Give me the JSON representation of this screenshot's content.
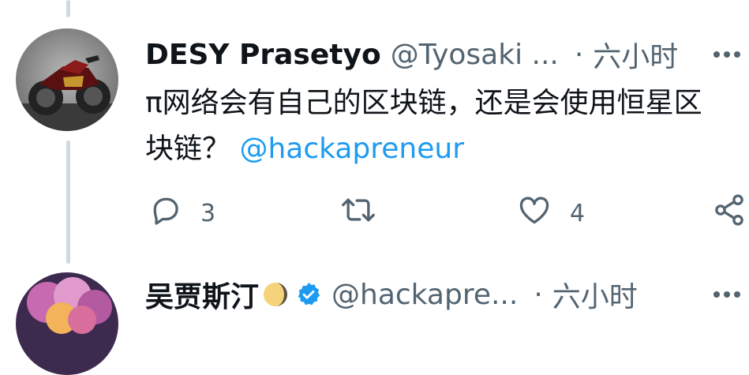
{
  "replies": [
    {
      "display_name": "DESY Prasetyo",
      "handle": "@Tyosaki ...",
      "separator": "·",
      "time": "六小时",
      "more_label": "•••",
      "text_before": "π网络会有自己的区块链，还是会使用恒星区块链？",
      "mention": "@hackapreneur",
      "reply_count": "3",
      "like_count": "4"
    },
    {
      "display_name": "吴贾斯汀",
      "handle": "@hackapre...",
      "separator": "·",
      "time": "六小时",
      "more_label": "•••"
    }
  ],
  "icons": {
    "reply": "reply-icon",
    "retweet": "retweet-icon",
    "like": "heart-icon",
    "share": "share-icon",
    "verified": "verified-badge-icon"
  },
  "colors": {
    "accent": "#1d9bf0",
    "secondary_text": "#536471",
    "thread_line": "#cfd9de"
  }
}
